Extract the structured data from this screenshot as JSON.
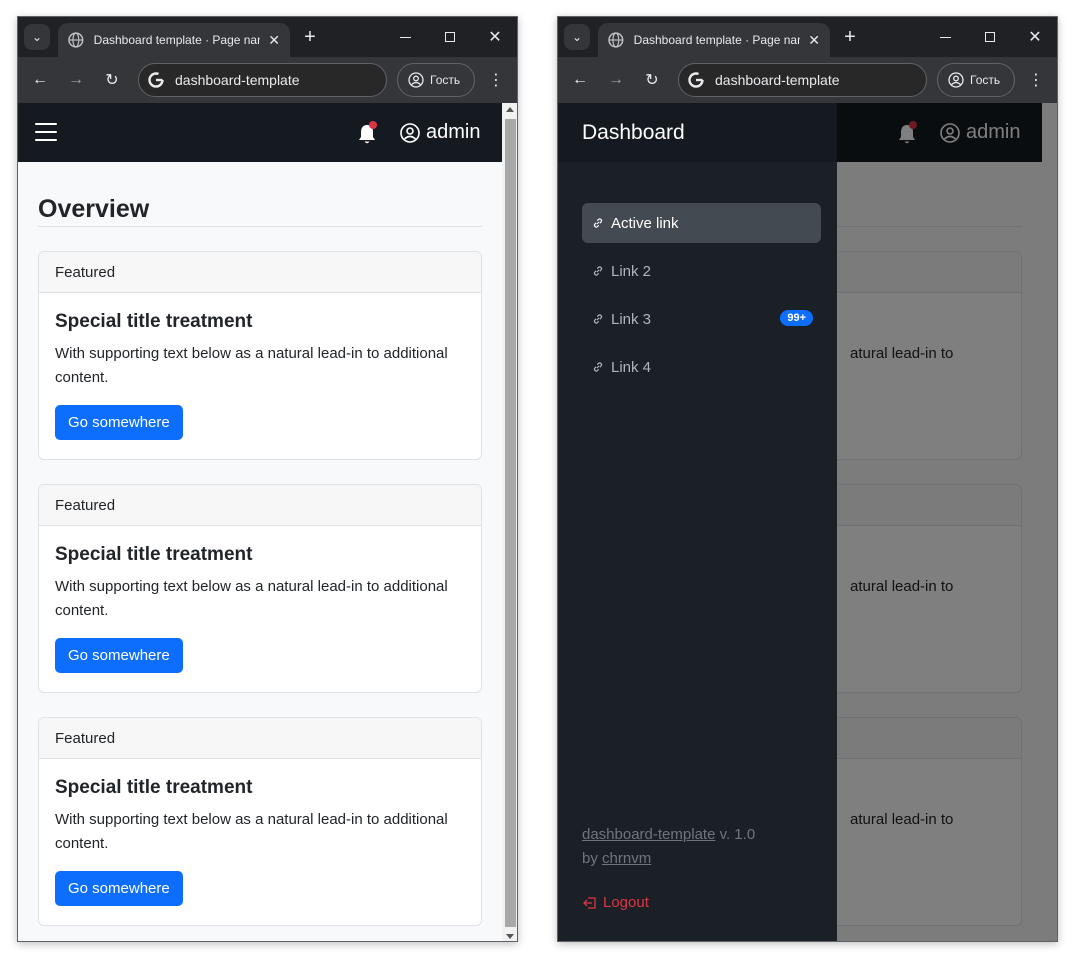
{
  "browser": {
    "tab_title": "Dashboard template · Page name",
    "url": "dashboard-template",
    "profile_label": "Гость"
  },
  "navbar": {
    "user_label": "admin"
  },
  "main": {
    "page_title": "Overview",
    "cards": [
      {
        "header": "Featured",
        "title": "Special title treatment",
        "text": "With supporting text below as a natural lead-in to additional content.",
        "button": "Go somewhere"
      },
      {
        "header": "Featured",
        "title": "Special title treatment",
        "text": "With supporting text below as a natural lead-in to additional content.",
        "button": "Go somewhere"
      },
      {
        "header": "Featured",
        "title": "Special title treatment",
        "text": "With supporting text below as a natural lead-in to additional content.",
        "button": "Go somewhere"
      }
    ],
    "partial_text": "atural lead-in to"
  },
  "sidebar": {
    "brand": "Dashboard",
    "links": [
      {
        "label": "Active link"
      },
      {
        "label": "Link 2"
      },
      {
        "label": "Link 3",
        "badge": "99+"
      },
      {
        "label": "Link 4"
      }
    ],
    "footer": {
      "project_link": "dashboard-template",
      "version": " v. 1.0",
      "by": "by ",
      "author_link": "chrnvm"
    },
    "logout": "Logout"
  },
  "colors": {
    "navbar_bg": "#141a20",
    "sidebar_bg": "#1b2027",
    "primary": "#0d6efd",
    "danger": "#dc3545"
  }
}
